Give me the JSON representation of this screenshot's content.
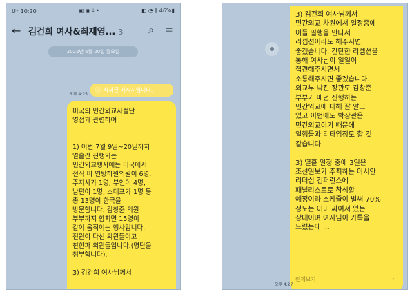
{
  "left": {
    "status": {
      "time": "U⁺ 10:20",
      "icons": "▣ ◉ ⤓ •",
      "battery": "◧ ◔ ⫼ 46%▮"
    },
    "header": {
      "title": "김건희 여사&최재영...",
      "count": "3"
    },
    "date": "2022년 6월 20일 월요일",
    "deleted": {
      "text": "삭제된 메시지입니다.",
      "time": "오후 4:25"
    },
    "message_time": "오후 4:25",
    "message": "미국의 민간외교사절단\n영접과 관련하여\n\n\n1) 이번 7월 9일~20일까지\n열흘간 진행되는\n민간외교행사에는 미국에서\n전직 미 연방하원의원이 6명,\n주지사가 1명, 부인이 4명,\n남편이 1명, 스태프가 1명 등\n총 13명이 한국을\n방문합니다. 김창준 의원\n부부까지 합치면 15명이\n같이 움직이는 행사입니다.\n전원이 다선 의원들이고\n친한파 의원들입니다.(명단을\n첨부합니다).\n\n3) 김건희 여사님께서"
  },
  "right": {
    "message": "3) 김건희 여사님께서\n민간외교 차원에서 일정중에\n이들 일행을 만나서\n리셉션이라도 해주시면\n좋겠습니다. 간단한 리셉션을\n통해 여사님이 일일이\n접견해주시면서\n소통해주시면 좋겠습니다.\n외교부 박진 장관도 김창준\n부부가 매년 진행하는\n민간외교에 대해 잘 알고\n있고 이번에도 박장관은\n민간외교이기 때문에\n일행들과 티타임정도 할 것\n같습니다.\n\n3) 열흘 일정 중에 3일은\n조선일보가 주최하는 아시안\n리더십 컨퍼런스에\n패널리스트로 참석할\n예정이라 스케쥴이 벌써 70%\n정도는 이미 짜여져 있는\n상태이며 여사님이 카톡을\n드렸는데 ...",
    "more_label": "전체보기",
    "more_arrow": "›",
    "time": "오후 4:27"
  },
  "colors": {
    "chat_bg": "#b6c8d9",
    "bubble": "#fde748"
  }
}
